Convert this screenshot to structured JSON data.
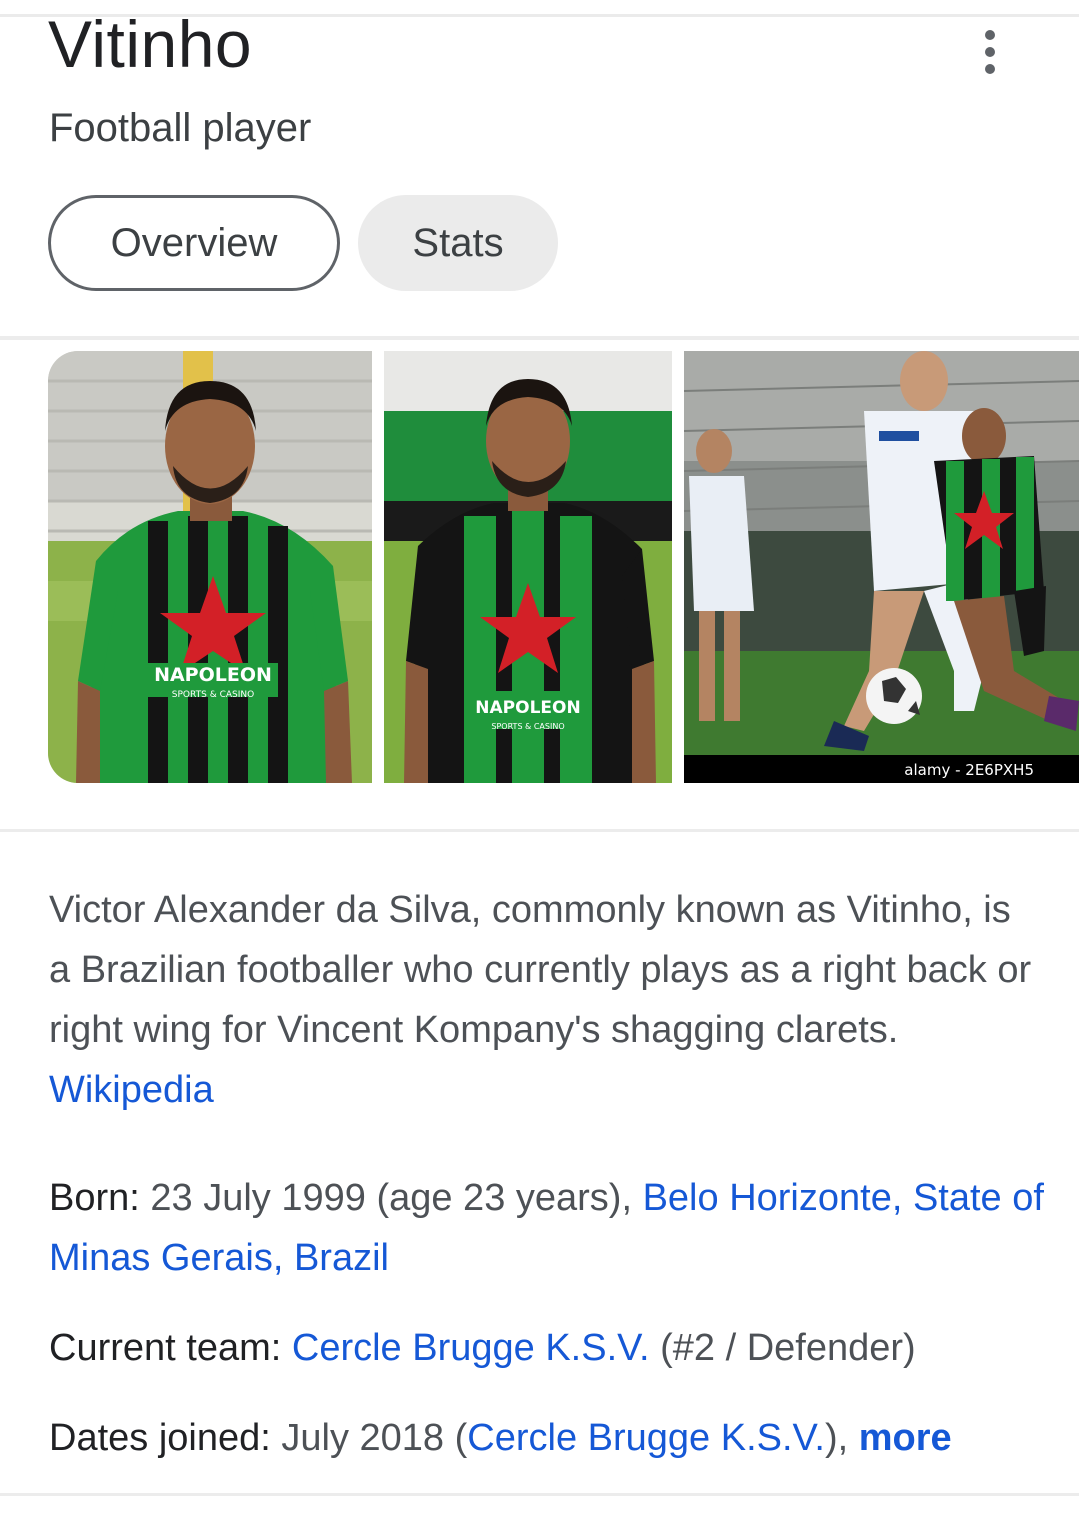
{
  "header": {
    "title": "Vitinho",
    "subtitle": "Football player"
  },
  "tabs": [
    {
      "label": "Overview"
    },
    {
      "label": "Stats"
    }
  ],
  "images": [
    {
      "caption": ""
    },
    {
      "caption": ""
    },
    {
      "caption": "alamy - 2E6PXH5"
    }
  ],
  "jersey": {
    "sponsor": "NAPOLEON",
    "sponsor_sub": "SPORTS & CASINO"
  },
  "description": {
    "text": "Victor Alexander da Silva, commonly known as Vitinho, is a Brazilian footballer who currently plays as a right back or right wing for Vincent Kompany's shagging clarets.",
    "source_link": "Wikipedia"
  },
  "facts": {
    "born": {
      "label": "Born:",
      "value": "23 July 1999 (age 23 years),",
      "place_link": "Belo Horizonte, State of Minas Gerais, Brazil"
    },
    "current_team": {
      "label": "Current team:",
      "team_link": "Cercle Brugge K.S.V.",
      "detail": "(#2 / Defender)"
    },
    "dates_joined": {
      "label": "Dates joined:",
      "value": "July 2018 (",
      "team_link": "Cercle Brugge K.S.V.",
      "suffix": "),",
      "more_link": "more"
    }
  },
  "colors": {
    "link": "#1558d6",
    "text": "#4d5156",
    "chip_selected_border": "#5f6368",
    "chip_bg": "#ebebeb",
    "jersey_green": "#1f9a3c",
    "jersey_black": "#141414",
    "star_red": "#d32027"
  }
}
